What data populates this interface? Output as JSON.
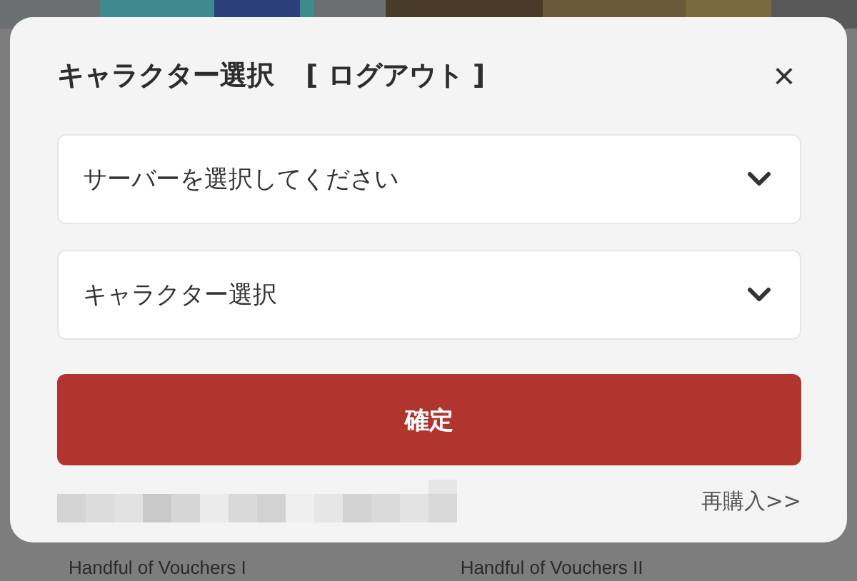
{
  "dialog": {
    "title": "キャラクター選択",
    "title_action": "[ ログアウト ]",
    "close": "×",
    "selects": [
      {
        "placeholder": "サーバーを選択してください"
      },
      {
        "placeholder": "キャラクター選択"
      }
    ],
    "confirm_button": "確定",
    "footer": {
      "link": "再購入>>"
    }
  },
  "background": {
    "items": [
      "Handful of Vouchers I",
      "Handful of Vouchers II"
    ]
  }
}
